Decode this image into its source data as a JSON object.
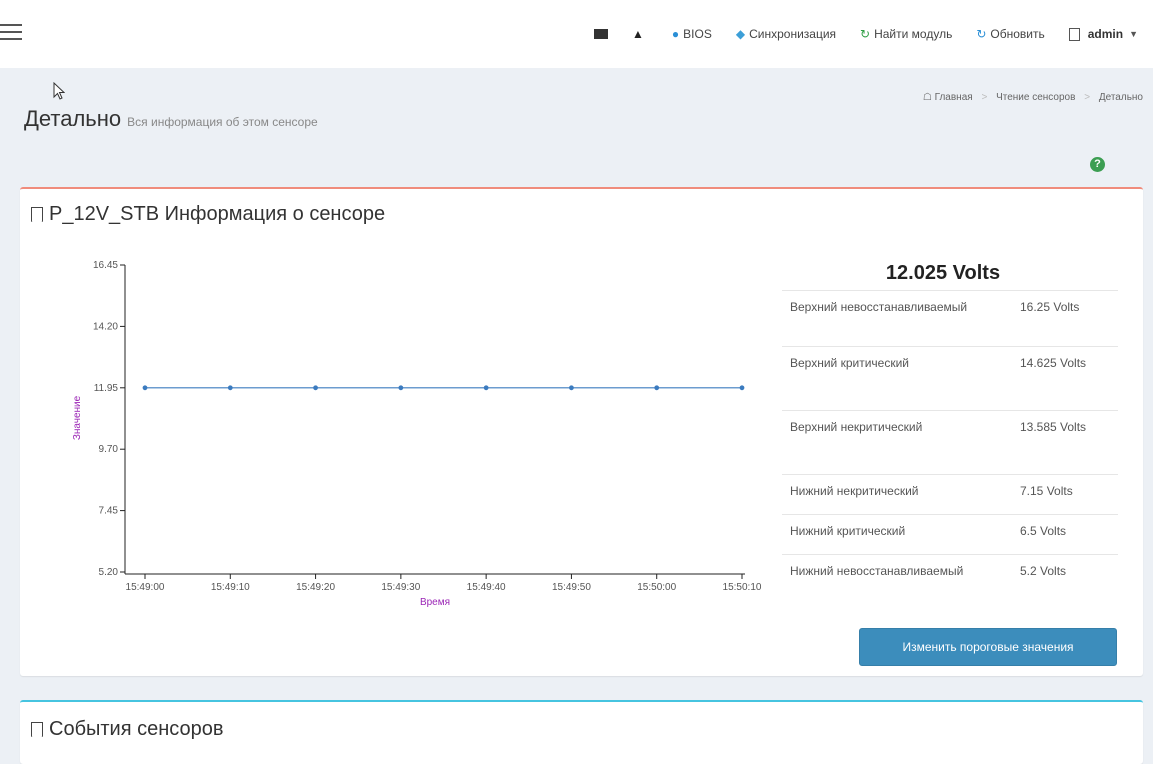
{
  "nav": {
    "bios": "BIOS",
    "sync": "Синхронизация",
    "find_module": "Найти модуль",
    "refresh": "Обновить",
    "user": "admin"
  },
  "header": {
    "title": "Детально",
    "subtitle": "Вся информация об этом сенсоре",
    "breadcrumb": [
      "Главная",
      "Чтение сенсоров",
      "Детально"
    ]
  },
  "sensor_box": {
    "title": "P_12V_STB Информация о сенсоре",
    "reading": "12.025 Volts",
    "thresholds": [
      {
        "label": "Верхний невосстанавливаемый",
        "value": "16.25 Volts"
      },
      {
        "label": "Верхний критический",
        "value": "14.625 Volts"
      },
      {
        "label": "Верхний некритический",
        "value": "13.585 Volts"
      },
      {
        "label": "Нижний некритический",
        "value": "7.15 Volts"
      },
      {
        "label": "Нижний критический",
        "value": "6.5 Volts"
      },
      {
        "label": "Нижний невосстанавливаемый",
        "value": "5.2 Volts"
      }
    ],
    "change_button": "Изменить пороговые значения"
  },
  "events_box": {
    "title": "События сенсоров"
  },
  "chart_data": {
    "type": "line",
    "xlabel": "Время",
    "ylabel": "Значение",
    "x": [
      "15:49:00",
      "15:49:10",
      "15:49:20",
      "15:49:30",
      "15:49:40",
      "15:49:50",
      "15:50:00",
      "15:50:10"
    ],
    "yticks": [
      "16.45",
      "14.20",
      "11.95",
      "9.70",
      "7.45",
      "5.20"
    ],
    "ylim": [
      5.2,
      16.45
    ],
    "series": [
      {
        "values": [
          11.95,
          11.95,
          11.95,
          11.95,
          11.95,
          11.95,
          11.95,
          11.95
        ]
      }
    ],
    "colors": {
      "line": "#3b7bbf",
      "axis_label": "#9b26b6"
    }
  }
}
